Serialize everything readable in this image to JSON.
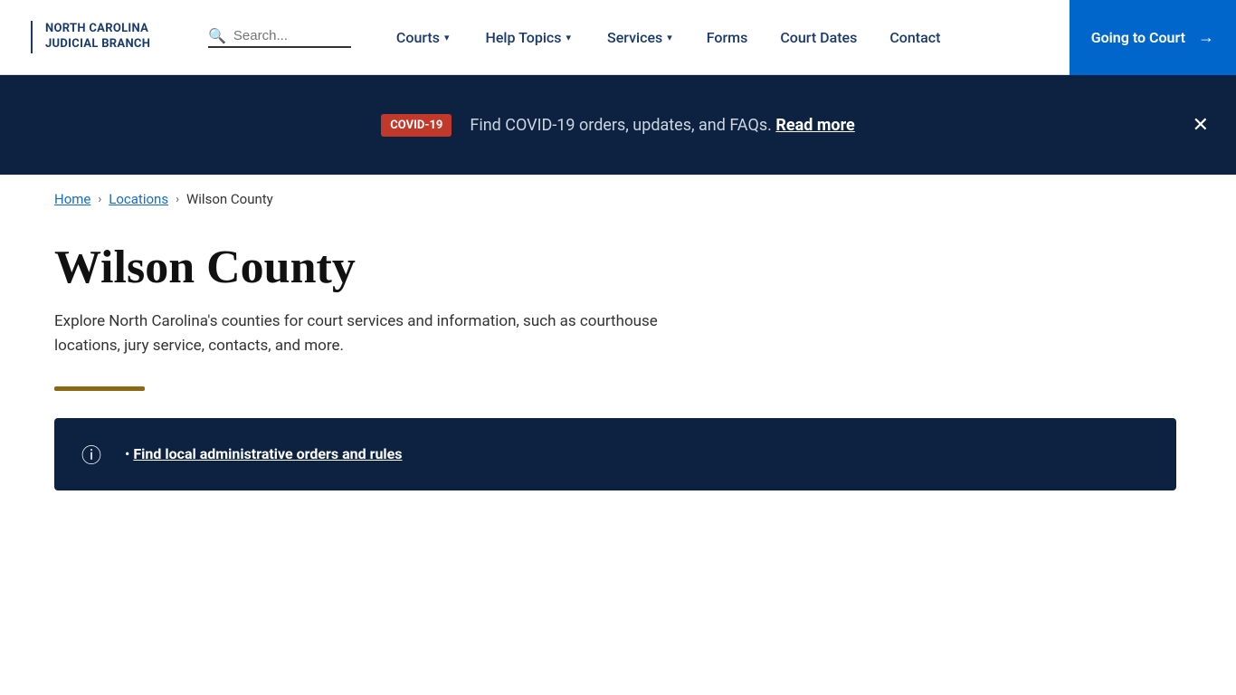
{
  "header": {
    "logo_line1": "NORTH CAROLINA",
    "logo_line2": "JUDICIAL BRANCH",
    "search_placeholder": "Search...",
    "nav": {
      "courts_label": "Courts",
      "help_topics_label": "Help Topics",
      "services_label": "Services",
      "forms_label": "Forms",
      "court_dates_label": "Court Dates",
      "contact_label": "Contact",
      "going_to_court_label": "Going to Court"
    }
  },
  "covid_banner": {
    "badge_label": "COVID-19",
    "text": "Find COVID-19 orders, updates, and FAQs.",
    "link_text": "Read more"
  },
  "breadcrumb": {
    "home_label": "Home",
    "locations_label": "Locations",
    "current_label": "Wilson County"
  },
  "page": {
    "title": "Wilson County",
    "description": "Explore North Carolina's counties for court services and information, such as courthouse locations, jury service, contacts, and more."
  },
  "info_box": {
    "link_text": "Find local administrative orders and rules"
  },
  "icons": {
    "search": "🔍",
    "chevron": "▾",
    "arrow_right": "→",
    "close": "✕",
    "info_circle": "ⓘ",
    "bullet": "•"
  }
}
